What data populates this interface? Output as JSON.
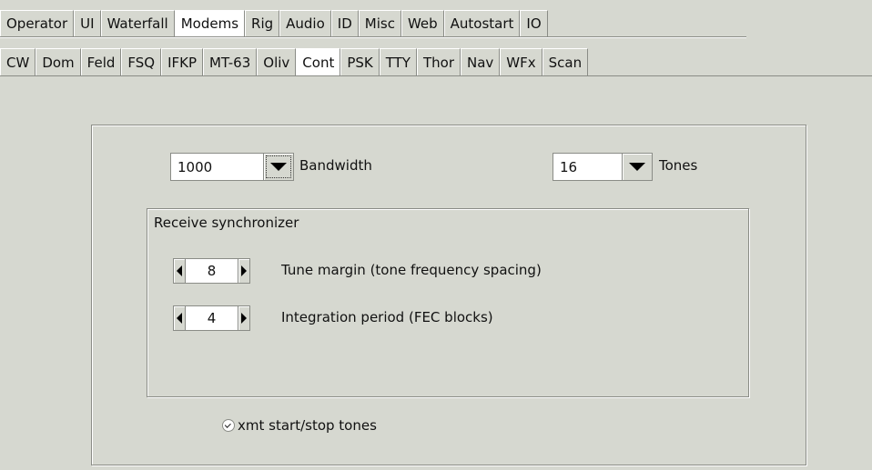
{
  "top_tabs": [
    {
      "label": "Operator",
      "active": false
    },
    {
      "label": "UI",
      "active": false
    },
    {
      "label": "Waterfall",
      "active": false
    },
    {
      "label": "Modems",
      "active": true
    },
    {
      "label": "Rig",
      "active": false
    },
    {
      "label": "Audio",
      "active": false
    },
    {
      "label": "ID",
      "active": false
    },
    {
      "label": "Misc",
      "active": false
    },
    {
      "label": "Web",
      "active": false
    },
    {
      "label": "Autostart",
      "active": false
    },
    {
      "label": "IO",
      "active": false
    }
  ],
  "modem_tabs": [
    {
      "label": "CW",
      "active": false
    },
    {
      "label": "Dom",
      "active": false
    },
    {
      "label": "Feld",
      "active": false
    },
    {
      "label": "FSQ",
      "active": false
    },
    {
      "label": "IFKP",
      "active": false
    },
    {
      "label": "MT-63",
      "active": false
    },
    {
      "label": "Oliv",
      "active": false
    },
    {
      "label": "Cont",
      "active": true
    },
    {
      "label": "PSK",
      "active": false
    },
    {
      "label": "TTY",
      "active": false
    },
    {
      "label": "Thor",
      "active": false
    },
    {
      "label": "Nav",
      "active": false
    },
    {
      "label": "WFx",
      "active": false
    },
    {
      "label": "Scan",
      "active": false
    }
  ],
  "bandwidth": {
    "value": "1000",
    "label": "Bandwidth"
  },
  "tones": {
    "value": "16",
    "label": "Tones"
  },
  "sync_group": {
    "label": "Receive synchronizer",
    "tune_margin": {
      "value": "8",
      "label": "Tune margin (tone frequency spacing)"
    },
    "integration": {
      "value": "4",
      "label": "Integration period (FEC blocks)"
    }
  },
  "xmt_tones": {
    "label": "xmt start/stop tones",
    "checked": true
  },
  "icons": {
    "dropdown": "chevron-down-icon",
    "decrement": "arrow-left-icon",
    "increment": "arrow-right-icon",
    "check": "check-icon"
  }
}
